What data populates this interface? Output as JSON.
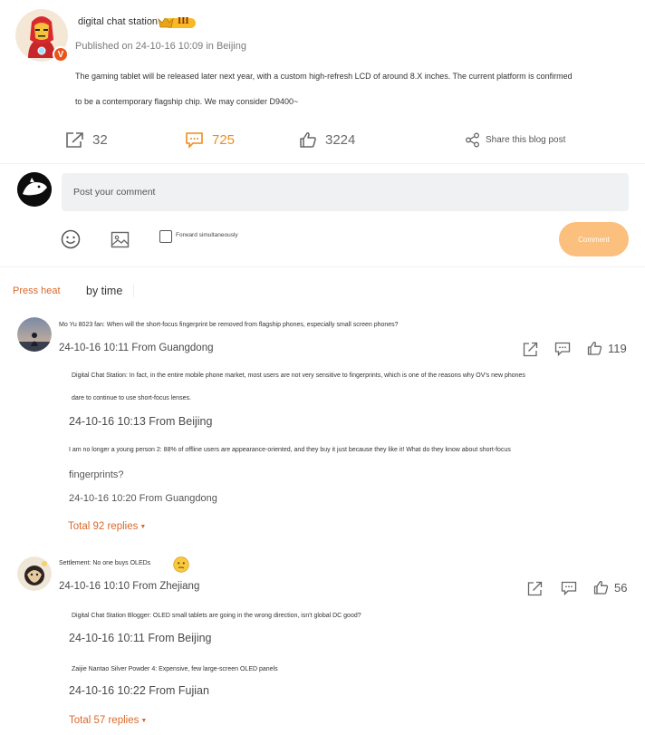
{
  "post": {
    "author": "digital chat station",
    "vip_level": "III",
    "published": "Published on 24-10-16 10:09 in Beijing",
    "body_line1": "The gaming tablet will be released later next year, with a custom high-refresh LCD of around 8.X inches. The current platform is confirmed",
    "body_line2": "to be a contemporary flagship chip. We may consider D9400~"
  },
  "actions": {
    "forward_count": "32",
    "comment_count": "725",
    "like_count": "3224",
    "share_label": "Share this blog post"
  },
  "composer": {
    "placeholder": "Post your comment",
    "forward_label": "Forward simultaneously",
    "submit_label": "Comment"
  },
  "sort_tabs": {
    "heat": "Press heat",
    "time": "by time"
  },
  "comments": [
    {
      "text": "Mo Yu 8023 fan: When will the short-focus fingerprint be removed from flagship phones, especially small screen phones?",
      "meta": "24-10-16 10:11 From Guangdong",
      "likes": "119",
      "replies": [
        {
          "text_line1": "Digital Chat Station: In fact, in the entire mobile phone market, most users are not very sensitive to fingerprints, which is one of the reasons why OV's new phones",
          "text_line2": "dare to continue to use short-focus lenses.",
          "meta": "24-10-16 10:13 From Beijing"
        },
        {
          "text_line1": "I am no longer a young person 2: 88% of offline users are appearance-oriented, and they buy it just because they like it! What do they know about short-focus",
          "text_line2": "fingerprints?",
          "meta": "24-10-16 10:20 From Guangdong"
        }
      ],
      "total": "Total 92 replies"
    },
    {
      "text": "Settlement: No one buys OLEDs",
      "meta": "24-10-16 10:10 From Zhejiang",
      "likes": "56",
      "replies": [
        {
          "text_line1": "Digital Chat Station Blogger: OLED small tablets are going in the wrong direction, isn't global DC good?",
          "meta": "24-10-16 10:11 From Beijing"
        },
        {
          "text_line1": "Zaijie Nantao Silver Powder 4: Expensive, few large-screen OLED panels",
          "meta": "24-10-16 10:22 From Fujian"
        }
      ],
      "total": "Total 57 replies"
    }
  ],
  "colors": {
    "accent": "#f28c1a",
    "link": "#d9692b",
    "submit_bg": "#fbbf7e",
    "input_bg": "#f0f1f3",
    "verified": "#e8541b"
  },
  "icons": [
    "forward-icon",
    "comment-icon",
    "like-icon",
    "share-icon",
    "emoji-icon",
    "image-icon",
    "verified-icon",
    "crown-icon",
    "confused-emoji-icon"
  ]
}
